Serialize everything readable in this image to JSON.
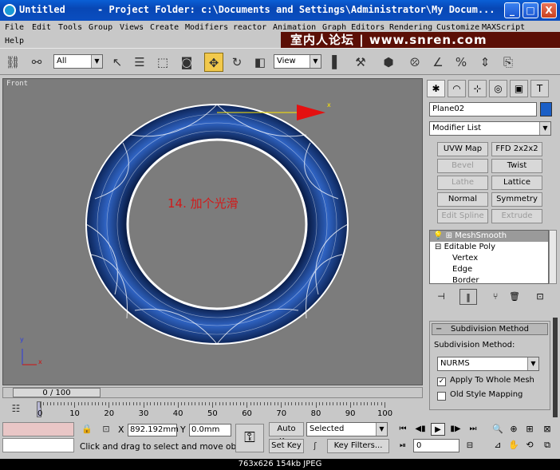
{
  "window": {
    "app_name": "Untitled",
    "title": "- Project Folder: c:\\Documents and Settings\\Administrator\\My Docum...",
    "minimize": "_",
    "maximize": "□",
    "close": "X"
  },
  "menu": {
    "row1": [
      "File",
      "Edit",
      "Tools",
      "Group",
      "Views",
      "Create",
      "Modifiers",
      "reactor",
      "Animation",
      "Graph Editors",
      "Rendering",
      "Customize",
      "MAXScript"
    ],
    "row2": [
      "Help"
    ]
  },
  "watermark": "室内人论坛 | www.snren.com",
  "toolbar": {
    "selection_filter": "All",
    "ref_coord": "View"
  },
  "viewport": {
    "label": "Front",
    "note": "14. 加个光滑",
    "gizmo_axis": "x",
    "axis_y": "y",
    "axis_x": "x"
  },
  "command_panel": {
    "object_name": "Plane02",
    "object_color": "#1b5fc6",
    "modifier_list": "Modifier List",
    "buttons": [
      {
        "label": "UVW Map",
        "enabled": true
      },
      {
        "label": "FFD 2x2x2",
        "enabled": true
      },
      {
        "label": "Bevel",
        "enabled": false
      },
      {
        "label": "Twist",
        "enabled": true
      },
      {
        "label": "Lathe",
        "enabled": false
      },
      {
        "label": "Lattice",
        "enabled": true
      },
      {
        "label": "Normal",
        "enabled": true
      },
      {
        "label": "Symmetry",
        "enabled": true
      },
      {
        "label": "Edit Spline",
        "enabled": false
      },
      {
        "label": "Extrude",
        "enabled": false
      }
    ],
    "stack": [
      {
        "label": "MeshSmooth",
        "selected": true
      },
      {
        "label": "Editable Poly",
        "selected": false
      },
      {
        "label": "Vertex",
        "selected": false
      },
      {
        "label": "Edge",
        "selected": false
      },
      {
        "label": "Border",
        "selected": false
      }
    ],
    "rollout": {
      "title": "Subdivision Method",
      "method_label": "Subdivision Method:",
      "method_value": "NURMS",
      "apply_whole_mesh": "Apply To Whole Mesh",
      "apply_whole_mesh_checked": true,
      "old_style_mapping": "Old Style Mapping",
      "old_style_mapping_checked": false
    }
  },
  "timeline": {
    "slider_label": "0 / 100",
    "ticks": [
      "0",
      "10",
      "20",
      "30",
      "40",
      "50",
      "60",
      "70",
      "80",
      "90",
      "100"
    ]
  },
  "status": {
    "x_label": "X",
    "x_value": "892.192mm",
    "y_label": "Y",
    "y_value": "0.0mm",
    "prompt": "Click and drag to select and move objects",
    "auto_key": "Auto Key",
    "set_key": "Set Key",
    "key_mode": "Selected",
    "key_filters": "Key Filters...",
    "current_frame": "0"
  },
  "caption": "763x626  154kb  JPEG"
}
